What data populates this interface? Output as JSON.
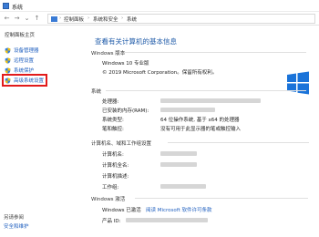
{
  "window": {
    "title": "系统"
  },
  "breadcrumb": {
    "items": [
      "控制面板",
      "系统和安全",
      "系统"
    ]
  },
  "sidebar": {
    "home": "控制面板主页",
    "items": [
      {
        "label": "设备管理器",
        "icon": "shield-icon"
      },
      {
        "label": "远程设置",
        "icon": "shield-icon"
      },
      {
        "label": "系统保护",
        "icon": "shield-icon"
      },
      {
        "label": "高级系统设置",
        "icon": "shield-icon",
        "highlighted": true
      }
    ],
    "see_also": "另请参阅",
    "security_link": "安全和维护"
  },
  "main": {
    "title": "查看有关计算机的基本信息",
    "windows_edition": {
      "heading": "Windows 版本",
      "edition": "Windows 10 专业版",
      "copyright": "© 2019 Microsoft Corporation。保留所有权利。"
    },
    "system": {
      "heading": "系统",
      "rows": [
        {
          "label": "处理器:",
          "value": ""
        },
        {
          "label": "已安装的内存(RAM):",
          "value": ""
        },
        {
          "label": "系统类型:",
          "value": "64 位操作系统, 基于 x64 的处理器"
        },
        {
          "label": "笔和触控:",
          "value": "没有可用于此显示器的笔或触控输入"
        }
      ]
    },
    "computer_name": {
      "heading": "计算机名、域和工作组设置",
      "rows": [
        {
          "label": "计算机名:"
        },
        {
          "label": "计算机全名:"
        },
        {
          "label": "计算机描述:"
        },
        {
          "label": "工作组:"
        }
      ]
    },
    "activation": {
      "heading": "Windows 激活",
      "status": "Windows 已激活",
      "license_link": "阅读 Microsoft 软件许可条款",
      "product_id_label": "产品 ID:"
    }
  },
  "colors": {
    "link": "#1f5fbf",
    "title": "#1e5aa8",
    "highlight_box": "#e21b1b",
    "logo": "#1a73d9"
  }
}
